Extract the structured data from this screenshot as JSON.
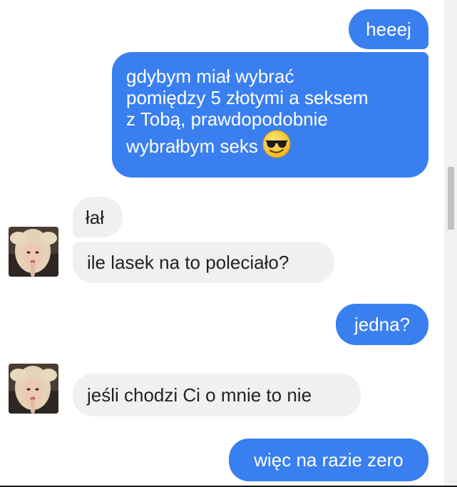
{
  "conversation": {
    "messages": [
      {
        "from": "me",
        "text": "heeej"
      },
      {
        "from": "me",
        "lines": [
          "gdybym miał wybrać",
          "pomiędzy 5 złotymi a seksem",
          "z Tobą, prawdopodobnie",
          "wybrałbym seks"
        ],
        "emoji": "smiling-face-with-sunglasses"
      },
      {
        "from": "them",
        "text": "łał"
      },
      {
        "from": "them",
        "text": "ile lasek na to poleciało?"
      },
      {
        "from": "me",
        "text": "jedna?"
      },
      {
        "from": "them",
        "text": "jeśli chodzi Ci o mnie to nie"
      },
      {
        "from": "me",
        "text": "więc na razie zero"
      }
    ]
  },
  "colors": {
    "outgoing_bubble": "#3a7ff0",
    "incoming_bubble": "#f0f0f0",
    "outgoing_text": "#ffffff",
    "incoming_text": "#222222"
  }
}
